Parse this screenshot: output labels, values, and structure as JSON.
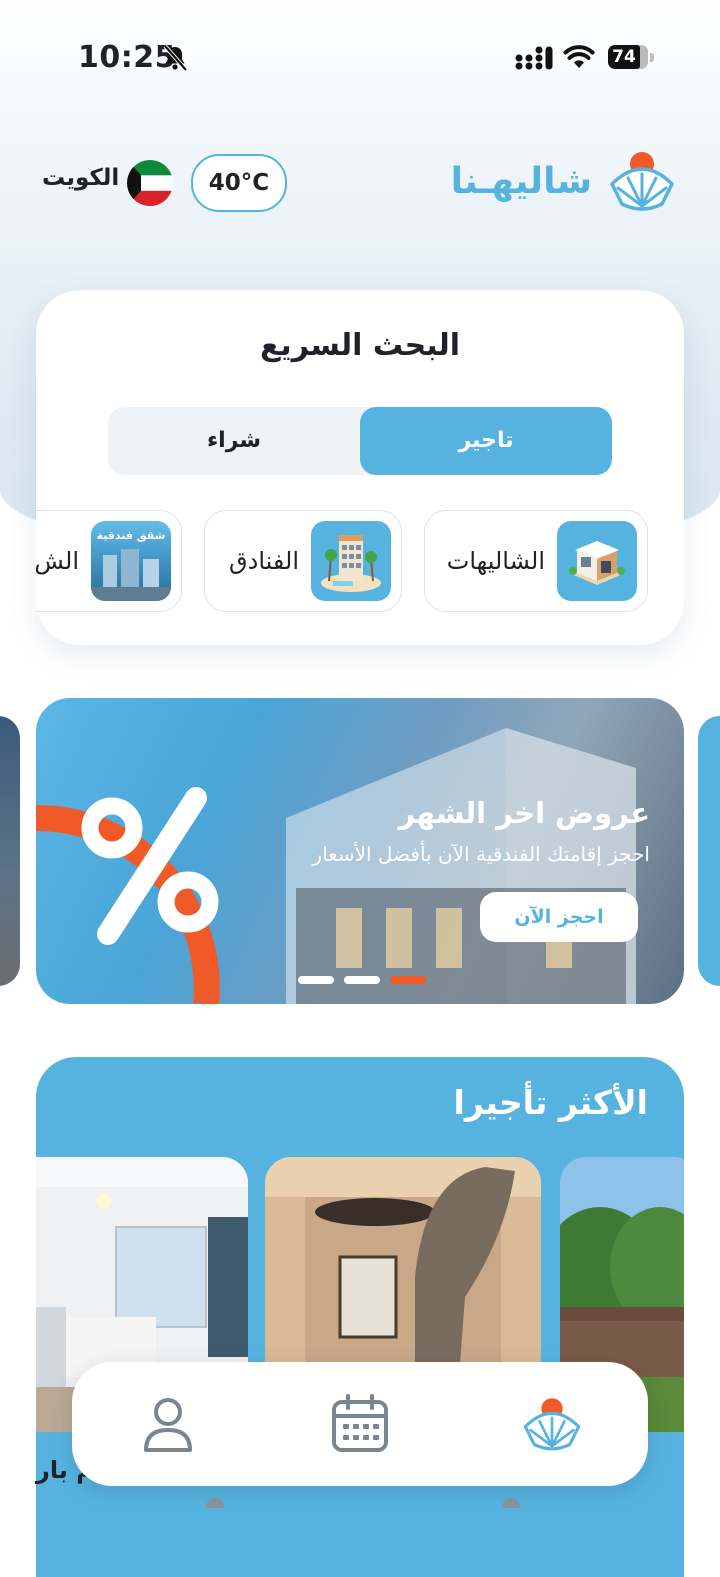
{
  "status_bar": {
    "time": "10:25",
    "battery": "74"
  },
  "header": {
    "logo_text": "شاليهـنا",
    "temperature": "40°C",
    "country": "الكويت"
  },
  "quick_search": {
    "title": "البحث السريع",
    "tabs": {
      "rent": "تاجير",
      "buy": "شراء"
    },
    "categories": [
      {
        "label": "الشاليهات",
        "icon": "chalet-icon"
      },
      {
        "label": "الفنادق",
        "icon": "hotel-icon"
      },
      {
        "label": "الش",
        "icon": "apartment-icon",
        "thumb_text": "شقق فندقية"
      }
    ]
  },
  "banner": {
    "title": "عروض اخر الشهر",
    "subtitle": "احجز إقامتك الفندقية الآن بأفضل الأسعار",
    "button": "احجز الآن",
    "slides": 3,
    "active_slide": 3
  },
  "most_rented": {
    "title": "الأكثر تأجيرا",
    "partial_caption": "م بار"
  },
  "bottom_nav": {
    "items": [
      {
        "name": "profile",
        "icon": "user-icon"
      },
      {
        "name": "bookings",
        "icon": "calendar-icon"
      },
      {
        "name": "home",
        "icon": "shell-logo-icon",
        "active": true
      }
    ]
  },
  "colors": {
    "primary": "#56b3e0",
    "accent": "#f05a28",
    "text": "#1f2329"
  }
}
